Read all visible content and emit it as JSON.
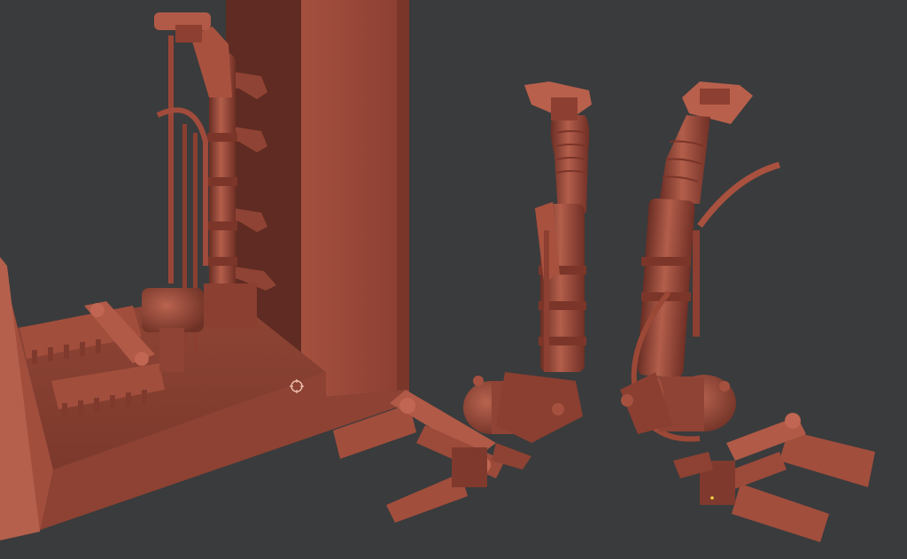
{
  "scene": {
    "background_color": "#3a3b3c",
    "material_color": "#9c4a3c",
    "material_shadow": "#5e2a22",
    "material_highlight": "#c46a58",
    "cursor_icon": "gizmo-circle-icon"
  }
}
